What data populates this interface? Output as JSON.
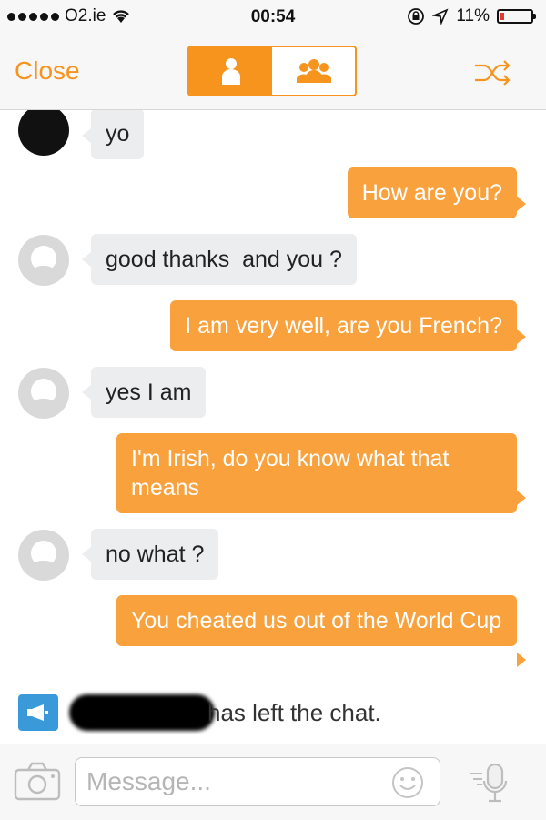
{
  "status_bar": {
    "carrier": "O2.ie",
    "time": "00:54",
    "battery": "11%",
    "battery_level": 0.11
  },
  "nav": {
    "close_label": "Close",
    "segments": [
      "single-user",
      "group"
    ],
    "active_segment": "single-user",
    "accent_color": "#f7941d"
  },
  "messages": [
    {
      "side": "in",
      "avatar": "photo",
      "text": "yo"
    },
    {
      "side": "out",
      "text": "How are you?"
    },
    {
      "side": "in",
      "avatar": "default",
      "text": "good thanks  and you ?"
    },
    {
      "side": "out",
      "text": "I am very well, are you French?"
    },
    {
      "side": "in",
      "avatar": "default",
      "text": "yes I am"
    },
    {
      "side": "out",
      "text": "I'm Irish, do you know what that means"
    },
    {
      "side": "in",
      "avatar": "default",
      "text": "no what ?"
    },
    {
      "side": "out",
      "text": "You cheated us out of the World Cup"
    }
  ],
  "system_message": {
    "text": "has left the chat."
  },
  "composer": {
    "placeholder": "Message...",
    "value": ""
  },
  "colors": {
    "outgoing_bubble": "#f9a13c",
    "incoming_bubble": "#ecedef",
    "system_icon": "#3a9ad9"
  },
  "icons": [
    "signal-dots-icon",
    "wifi-icon",
    "rotation-lock-icon",
    "location-arrow-icon",
    "battery-icon",
    "person-icon",
    "group-icon",
    "shuffle-icon",
    "megaphone-icon",
    "camera-icon",
    "smiley-icon",
    "microphone-icon"
  ]
}
